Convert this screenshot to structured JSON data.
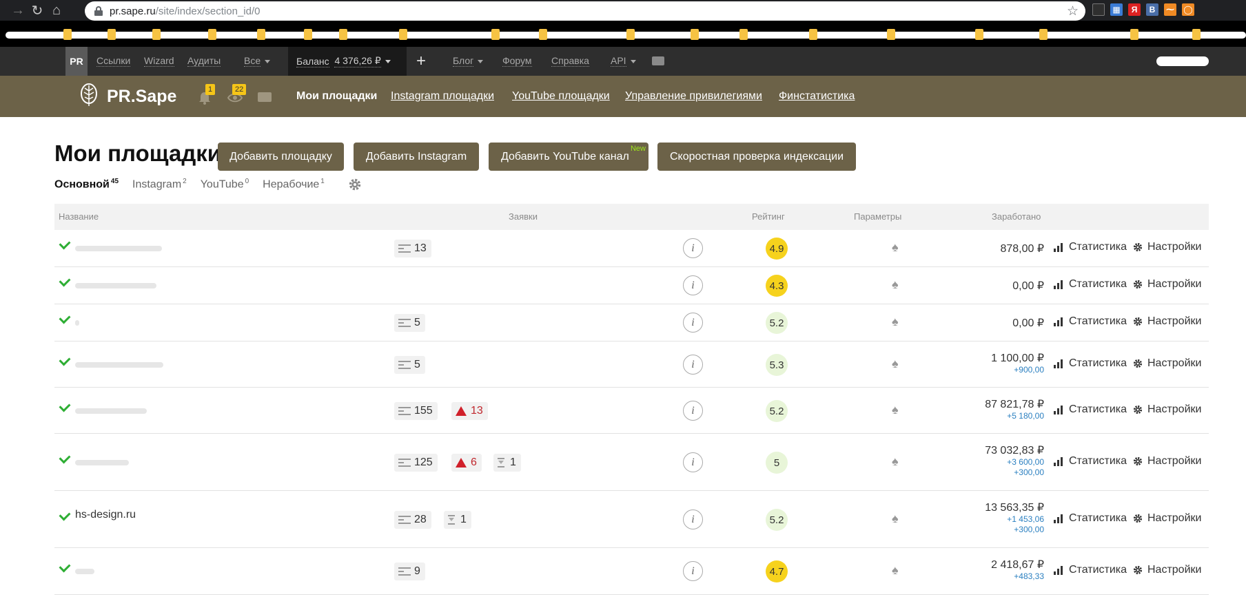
{
  "browser": {
    "url_host": "pr.sape.ru",
    "url_path": "/site/index/section_id/0"
  },
  "topnav": {
    "pr_label": "PR",
    "links": [
      "Ссылки",
      "Wizard",
      "Аудиты",
      "Все"
    ],
    "balance_label": "Баланс",
    "balance_value": "4 376,26 ₽",
    "plus": "+",
    "right_links": [
      "Блог",
      "Форум",
      "Справка",
      "API"
    ]
  },
  "brand": {
    "logo_text": "PR.Sape",
    "bell_badge": "1",
    "eye_badge": "22",
    "links": [
      "Мои площадки",
      "Instagram площадки",
      "YouTube площадки",
      "Управление привилегиями",
      "Финстатистика"
    ]
  },
  "page": {
    "title": "Мои площадки",
    "buttons": [
      "Добавить площадку",
      "Добавить Instagram",
      "Добавить YouTube канал",
      "Скоростная проверка индексации"
    ],
    "new_badge": "New"
  },
  "tabs": [
    {
      "label": "Основной",
      "count": "45"
    },
    {
      "label": "Instagram",
      "count": "2"
    },
    {
      "label": "YouTube",
      "count": "0"
    },
    {
      "label": "Нерабочие",
      "count": "1"
    }
  ],
  "table": {
    "headers": [
      "Название",
      "Заявки",
      "Рейтинг",
      "Параметры",
      "Заработано"
    ],
    "stats_label": "Статистика",
    "settings_label": "Настройки",
    "info_glyph": "i",
    "rows": [
      {
        "name": "",
        "req": "13",
        "alert": "",
        "wait": "",
        "rating": "4.9",
        "rating_level": "high",
        "earned": "878,00 ₽",
        "subs": []
      },
      {
        "name": "",
        "req": "",
        "alert": "",
        "wait": "",
        "rating": "4.3",
        "rating_level": "high",
        "earned": "0,00 ₽",
        "subs": []
      },
      {
        "name": "",
        "req": "5",
        "alert": "",
        "wait": "",
        "rating": "5.2",
        "rating_level": "mid",
        "earned": "0,00 ₽",
        "subs": []
      },
      {
        "name": "",
        "req": "5",
        "alert": "",
        "wait": "",
        "rating": "5.3",
        "rating_level": "mid",
        "earned": "1 100,00 ₽",
        "subs": [
          "+900,00"
        ]
      },
      {
        "name": "",
        "req": "155",
        "alert": "13",
        "wait": "",
        "rating": "5.2",
        "rating_level": "mid",
        "earned": "87 821,78 ₽",
        "subs": [
          "+5 180,00"
        ]
      },
      {
        "name": "",
        "req": "125",
        "alert": "6",
        "wait": "1",
        "rating": "5",
        "rating_level": "mid",
        "earned": "73 032,83 ₽",
        "subs": [
          "+3 600,00",
          "+300,00"
        ]
      },
      {
        "name": "hs-design.ru",
        "req": "28",
        "alert": "",
        "wait": "1",
        "rating": "5.2",
        "rating_level": "mid",
        "earned": "13 563,35 ₽",
        "subs": [
          "+1 453,06",
          "+300,00"
        ]
      },
      {
        "name": "",
        "req": "9",
        "alert": "",
        "wait": "",
        "rating": "4.7",
        "rating_level": "high",
        "earned": "2 418,67 ₽",
        "subs": [
          "+483,33"
        ]
      }
    ]
  },
  "colors": {
    "brand_bg": "#6c6248",
    "topnav_bg": "#2e2e2e",
    "check_green": "#2eae34",
    "rating_high": "#f6d21d",
    "rating_mid": "#e8f5d8",
    "alert_red": "#c0272d",
    "sub_blue": "#2a7fc0",
    "new_green": "#9ee81a"
  }
}
